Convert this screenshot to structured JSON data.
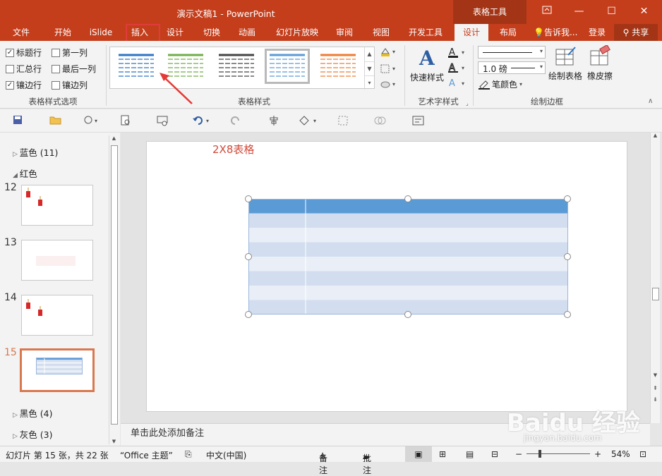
{
  "window": {
    "title": "演示文稿1 - PowerPoint",
    "context_group": "表格工具",
    "restore_icon": "ribbon-display-icon",
    "minimize": "—",
    "maximize": "☐",
    "close": "✕"
  },
  "tabs": [
    "文件",
    "开始",
    "iSlide",
    "插入",
    "设计",
    "切换",
    "动画",
    "幻灯片放映",
    "审阅",
    "视图",
    "开发工具",
    "设计",
    "布局"
  ],
  "tell_me": "告诉我...",
  "login": "登录",
  "share": "共享",
  "table_style_options": {
    "header_row": "标题行",
    "first_column": "第一列",
    "total_row": "汇总行",
    "last_column": "最后一列",
    "banded_rows": "镶边行",
    "banded_columns": "镶边列",
    "group_label": "表格样式选项"
  },
  "table_styles": {
    "group_label": "表格样式",
    "thumbs": [
      "#2e74c4",
      "#70ad47",
      "#444444",
      "#5b9bd5",
      "#ed7d31"
    ]
  },
  "wordart": {
    "quick_styles": "快速样式",
    "group_label": "艺术字样式"
  },
  "draw_borders": {
    "weight": "1.0 磅",
    "pen_color": "笔颜色",
    "draw_table": "绘制表格",
    "eraser": "橡皮擦",
    "group_label": "绘制边框"
  },
  "sections": {
    "blue": "蓝色 (11)",
    "red": "红色",
    "black": "黑色 (4)",
    "gray": "灰色 (3)"
  },
  "slide_numbers": [
    "12",
    "13",
    "14",
    "15"
  ],
  "slide": {
    "title": "2X8表格"
  },
  "notes_placeholder": "单击此处添加备注",
  "status": {
    "slide_info": "幻灯片 第 15 张，共 22 张",
    "theme": "“Office 主题”",
    "language": "中文(中国)",
    "notes": "备注",
    "comments": "批注",
    "zoom": "54%"
  },
  "watermark": {
    "brand": "Baidu 经验",
    "url": "jingyan.baidu.com"
  }
}
